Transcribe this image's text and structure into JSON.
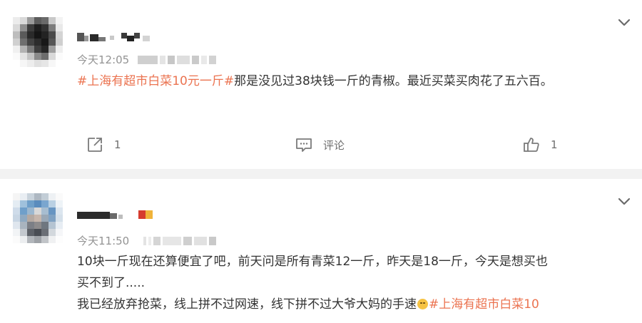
{
  "colors": {
    "topic": "#eb7350",
    "text": "#333333",
    "muted": "#939393",
    "separator": "#f2f2f2"
  },
  "posts": [
    {
      "time": "今天12:05",
      "topic_tag": "#上海有超市白菜10元一斤#",
      "text": "那是没见过38块钱一斤的青椒。最近买菜买肉花了五六百。",
      "actions": {
        "repost_icon": "share-icon",
        "repost_count": "1",
        "comment_icon": "comment-icon",
        "comment_label": "评论",
        "like_icon": "thumbs-up-icon",
        "like_count": "1"
      },
      "menu_icon": "chevron-down-icon"
    },
    {
      "time": "今天11:50",
      "line1": "10块一斤现在还算便宜了吧，前天问是所有青菜12一斤，昨天是18一斤，今天是想买也",
      "line2": "买不到了.....",
      "line3": "我已经放弃抢菜，线上拼不过网速，线下拼不过大爷大妈的手速",
      "emoji": "upside-down-face-emoji",
      "topic_tag": "#上海有超市白菜10",
      "menu_icon": "chevron-down-icon"
    }
  ]
}
